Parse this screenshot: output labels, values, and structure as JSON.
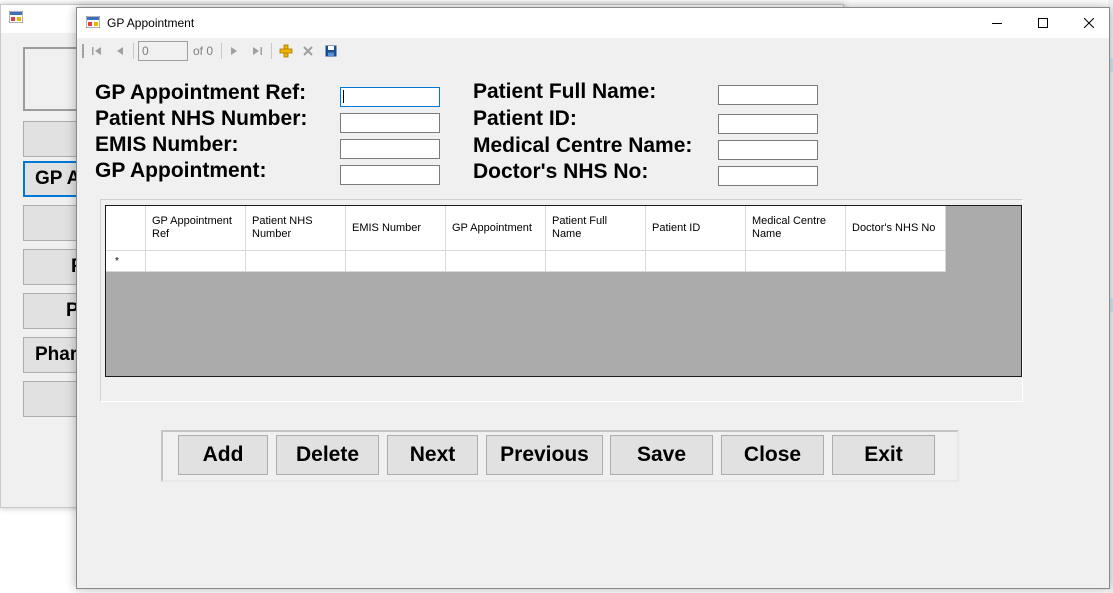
{
  "background_window": {
    "buttons": [
      {
        "label": ""
      },
      {
        "label": "GP A"
      },
      {
        "label": ""
      },
      {
        "label": "F"
      },
      {
        "label": "P"
      },
      {
        "label": "Phar"
      },
      {
        "label": ""
      }
    ]
  },
  "window": {
    "title": "GP Appointment",
    "controls": [
      "minimize-icon",
      "maximize-icon",
      "close-icon"
    ]
  },
  "navigator": {
    "position": "0",
    "count_label": "of 0",
    "icons": [
      "move-first-icon",
      "move-previous-icon",
      "move-next-icon",
      "move-last-icon",
      "add-new-icon",
      "delete-icon",
      "save-icon"
    ]
  },
  "form": {
    "left_fields": [
      {
        "label": "GP Appointment Ref:",
        "value": ""
      },
      {
        "label": "Patient NHS Number:",
        "value": ""
      },
      {
        "label": "EMIS Number:",
        "value": ""
      },
      {
        "label": "GP Appointment:",
        "value": ""
      }
    ],
    "right_fields": [
      {
        "label": "Patient Full Name:",
        "value": ""
      },
      {
        "label": "Patient ID:",
        "value": ""
      },
      {
        "label": "Medical Centre Name:",
        "value": ""
      },
      {
        "label": "Doctor's NHS No:",
        "value": ""
      }
    ]
  },
  "grid": {
    "columns": [
      "GP Appointment Ref",
      "Patient NHS Number",
      "EMIS Number",
      "GP Appointment",
      "Patient Full Name",
      "Patient ID",
      "Medical Centre Name",
      "Doctor's NHS No"
    ],
    "new_row_marker": "*"
  },
  "actions": {
    "add": "Add",
    "delete": "Delete",
    "next": "Next",
    "previous": "Previous",
    "save": "Save",
    "close": "Close",
    "exit": "Exit"
  },
  "colors": {
    "focus_accent": "#0078d7",
    "grid_background": "#ababab",
    "form_background": "#f0f0f0",
    "add_icon": "#f0b400",
    "save_icon": "#1a4d8f"
  }
}
